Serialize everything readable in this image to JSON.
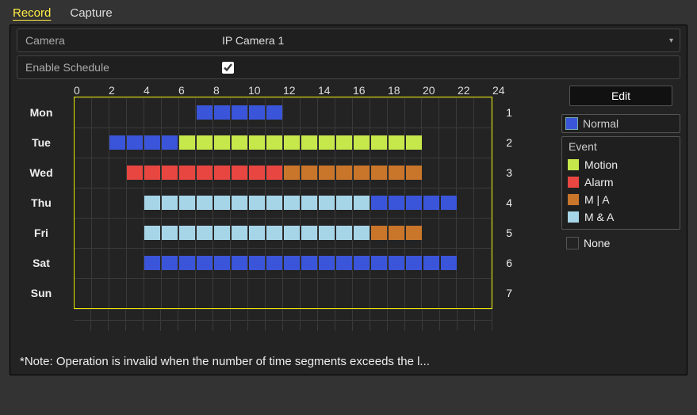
{
  "tabs": {
    "record": "Record",
    "capture": "Capture",
    "active": "record"
  },
  "fields": {
    "camera_label": "Camera",
    "camera_value": "IP Camera 1",
    "enable_label": "Enable Schedule",
    "enable_checked": true
  },
  "hours": [
    "0",
    "2",
    "4",
    "6",
    "8",
    "10",
    "12",
    "14",
    "16",
    "18",
    "20",
    "22",
    "24"
  ],
  "days": [
    {
      "name": "Mon",
      "num": "1",
      "segments": [
        {
          "start": 7,
          "len": 5,
          "type": "normal"
        }
      ]
    },
    {
      "name": "Tue",
      "num": "2",
      "segments": [
        {
          "start": 2,
          "len": 4,
          "type": "normal"
        },
        {
          "start": 6,
          "len": 14,
          "type": "motion"
        }
      ]
    },
    {
      "name": "Wed",
      "num": "3",
      "segments": [
        {
          "start": 3,
          "len": 9,
          "type": "alarm"
        },
        {
          "start": 12,
          "len": 8,
          "type": "ma"
        }
      ]
    },
    {
      "name": "Thu",
      "num": "4",
      "segments": [
        {
          "start": 4,
          "len": 13,
          "type": "manda"
        },
        {
          "start": 17,
          "len": 5,
          "type": "normal"
        }
      ]
    },
    {
      "name": "Fri",
      "num": "5",
      "segments": [
        {
          "start": 4,
          "len": 13,
          "type": "manda"
        },
        {
          "start": 17,
          "len": 3,
          "type": "ma"
        }
      ]
    },
    {
      "name": "Sat",
      "num": "6",
      "segments": [
        {
          "start": 4,
          "len": 18,
          "type": "normal"
        }
      ]
    },
    {
      "name": "Sun",
      "num": "7",
      "segments": []
    }
  ],
  "side": {
    "edit": "Edit",
    "normal": "Normal",
    "event_title": "Event",
    "motion": "Motion",
    "alarm": "Alarm",
    "m_or_a": "M | A",
    "m_and_a": "M & A",
    "none": "None"
  },
  "note": "*Note: Operation is invalid when the number of time segments exceeds the l...",
  "chart_data": {
    "type": "table",
    "title": "Recording Schedule",
    "columns_hours": [
      "0",
      "1",
      "2",
      "3",
      "4",
      "5",
      "6",
      "7",
      "8",
      "9",
      "10",
      "11",
      "12",
      "13",
      "14",
      "15",
      "16",
      "17",
      "18",
      "19",
      "20",
      "21",
      "22",
      "23"
    ],
    "rows": [
      {
        "day": "Mon",
        "segments": [
          {
            "from": 7,
            "to": 12,
            "type": "Normal"
          }
        ]
      },
      {
        "day": "Tue",
        "segments": [
          {
            "from": 2,
            "to": 6,
            "type": "Normal"
          },
          {
            "from": 6,
            "to": 20,
            "type": "Motion"
          }
        ]
      },
      {
        "day": "Wed",
        "segments": [
          {
            "from": 3,
            "to": 12,
            "type": "Alarm"
          },
          {
            "from": 12,
            "to": 20,
            "type": "M|A"
          }
        ]
      },
      {
        "day": "Thu",
        "segments": [
          {
            "from": 4,
            "to": 17,
            "type": "M&A"
          },
          {
            "from": 17,
            "to": 22,
            "type": "Normal"
          }
        ]
      },
      {
        "day": "Fri",
        "segments": [
          {
            "from": 4,
            "to": 17,
            "type": "M&A"
          },
          {
            "from": 17,
            "to": 20,
            "type": "M|A"
          }
        ]
      },
      {
        "day": "Sat",
        "segments": [
          {
            "from": 4,
            "to": 22,
            "type": "Normal"
          }
        ]
      },
      {
        "day": "Sun",
        "segments": []
      }
    ],
    "legend": [
      "Normal",
      "Motion",
      "Alarm",
      "M|A",
      "M&A",
      "None"
    ]
  }
}
